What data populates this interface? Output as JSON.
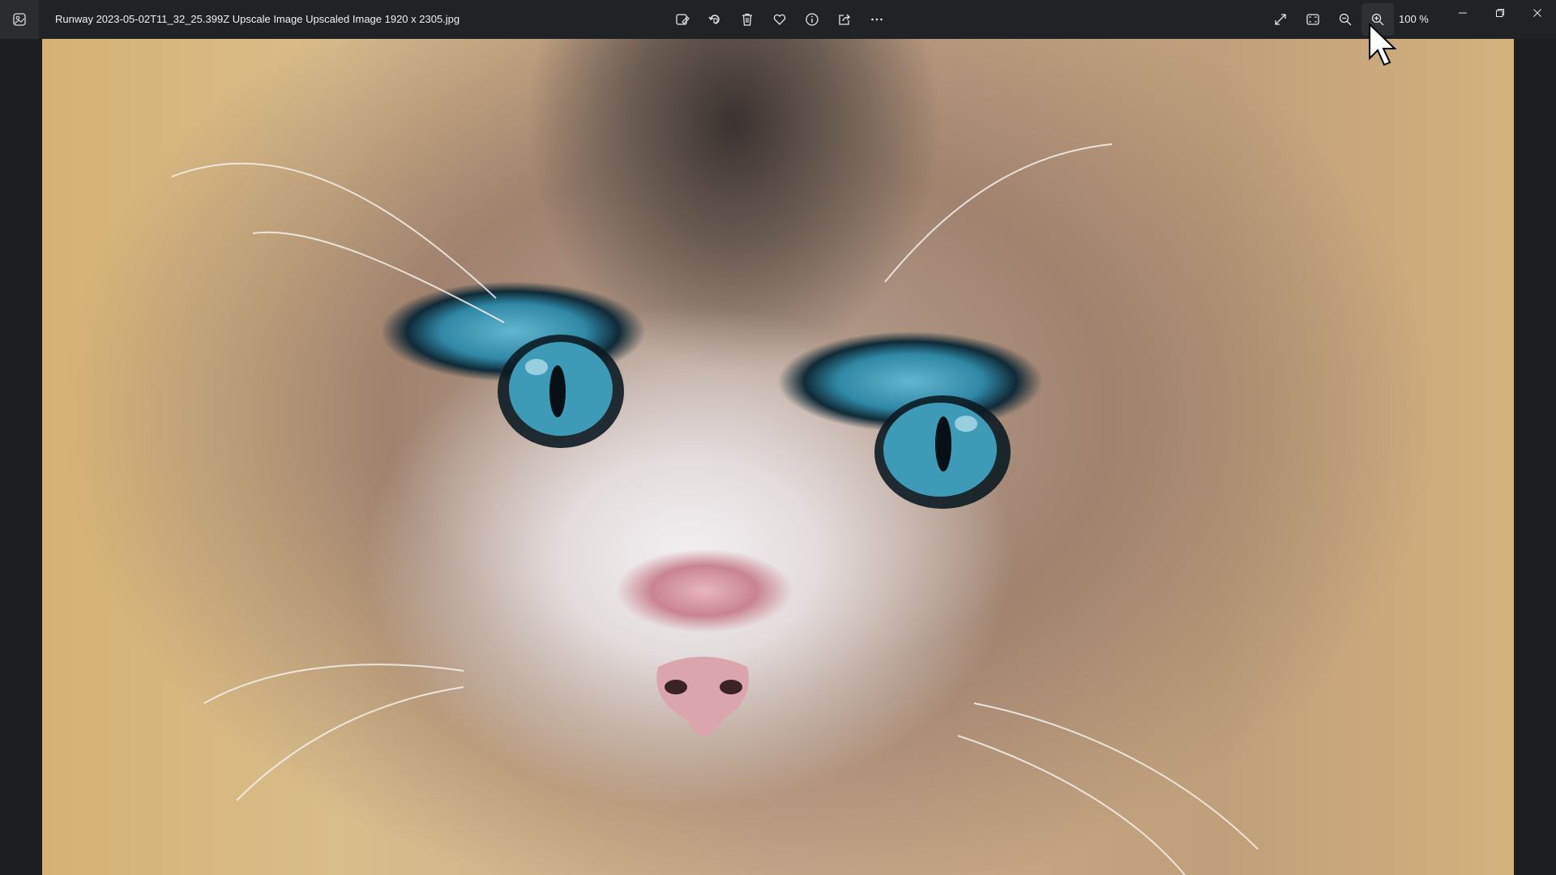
{
  "window": {
    "filename": "Runway 2023-05-02T11_32_25.399Z Upscale Image Upscaled Image 1920 x 2305.jpg"
  },
  "toolbar": {
    "items": [
      {
        "name": "edit-image",
        "icon": "edit-image-icon"
      },
      {
        "name": "rotate",
        "icon": "rotate-icon"
      },
      {
        "name": "delete",
        "icon": "trash-icon"
      },
      {
        "name": "favorite",
        "icon": "heart-icon"
      },
      {
        "name": "file-info",
        "icon": "info-icon"
      },
      {
        "name": "share",
        "icon": "share-icon"
      },
      {
        "name": "more",
        "icon": "more-icon"
      }
    ]
  },
  "view": {
    "zoom_label": "100 %",
    "tools": [
      "fullscreen-icon",
      "fit-window-icon",
      "zoom-out-icon",
      "zoom-in-icon"
    ]
  },
  "window_controls": [
    "minimize-icon",
    "restore-icon",
    "close-icon"
  ],
  "image": {
    "subject": "cat-photo"
  },
  "colors": {
    "chrome": "#202225",
    "background": "#1c1e21",
    "text": "#f0f0f0"
  }
}
